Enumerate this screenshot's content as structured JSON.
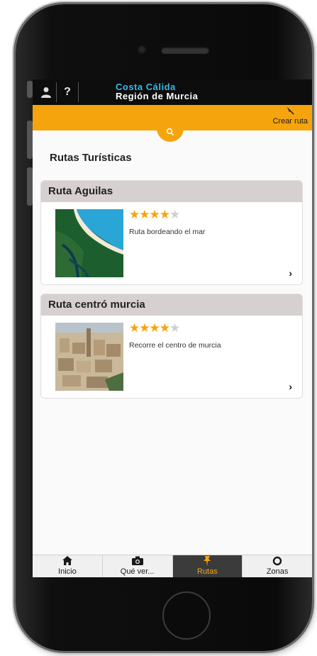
{
  "header": {
    "brand_line1": "Costa Cálida",
    "brand_line2": "Región de Murcia",
    "user_icon": "user-icon",
    "help_label": "?"
  },
  "toolbar": {
    "crear_label": "Crear ruta",
    "crear_icon": "pin-icon",
    "search_icon": "search-icon"
  },
  "page": {
    "title": "Rutas Turísticas"
  },
  "routes": [
    {
      "title": "Ruta Aguilas",
      "rating": 4,
      "max_rating": 5,
      "description": "Ruta bordeando el mar"
    },
    {
      "title": "Ruta centró murcia",
      "rating": 4,
      "max_rating": 5,
      "description": "Recorre el centro de murcia"
    }
  ],
  "tabs": [
    {
      "label": "Inicio",
      "icon": "home-icon",
      "active": false
    },
    {
      "label": "Qué ver...",
      "icon": "camera-icon",
      "active": false
    },
    {
      "label": "Rutas",
      "icon": "pin-icon",
      "active": true
    },
    {
      "label": "Zonas",
      "icon": "target-icon",
      "active": false
    }
  ],
  "colors": {
    "accent": "#f6a40d",
    "brand_blue": "#38b8e6",
    "card_header": "#d6d0d0",
    "tab_active_bg": "#3b3b3b"
  }
}
